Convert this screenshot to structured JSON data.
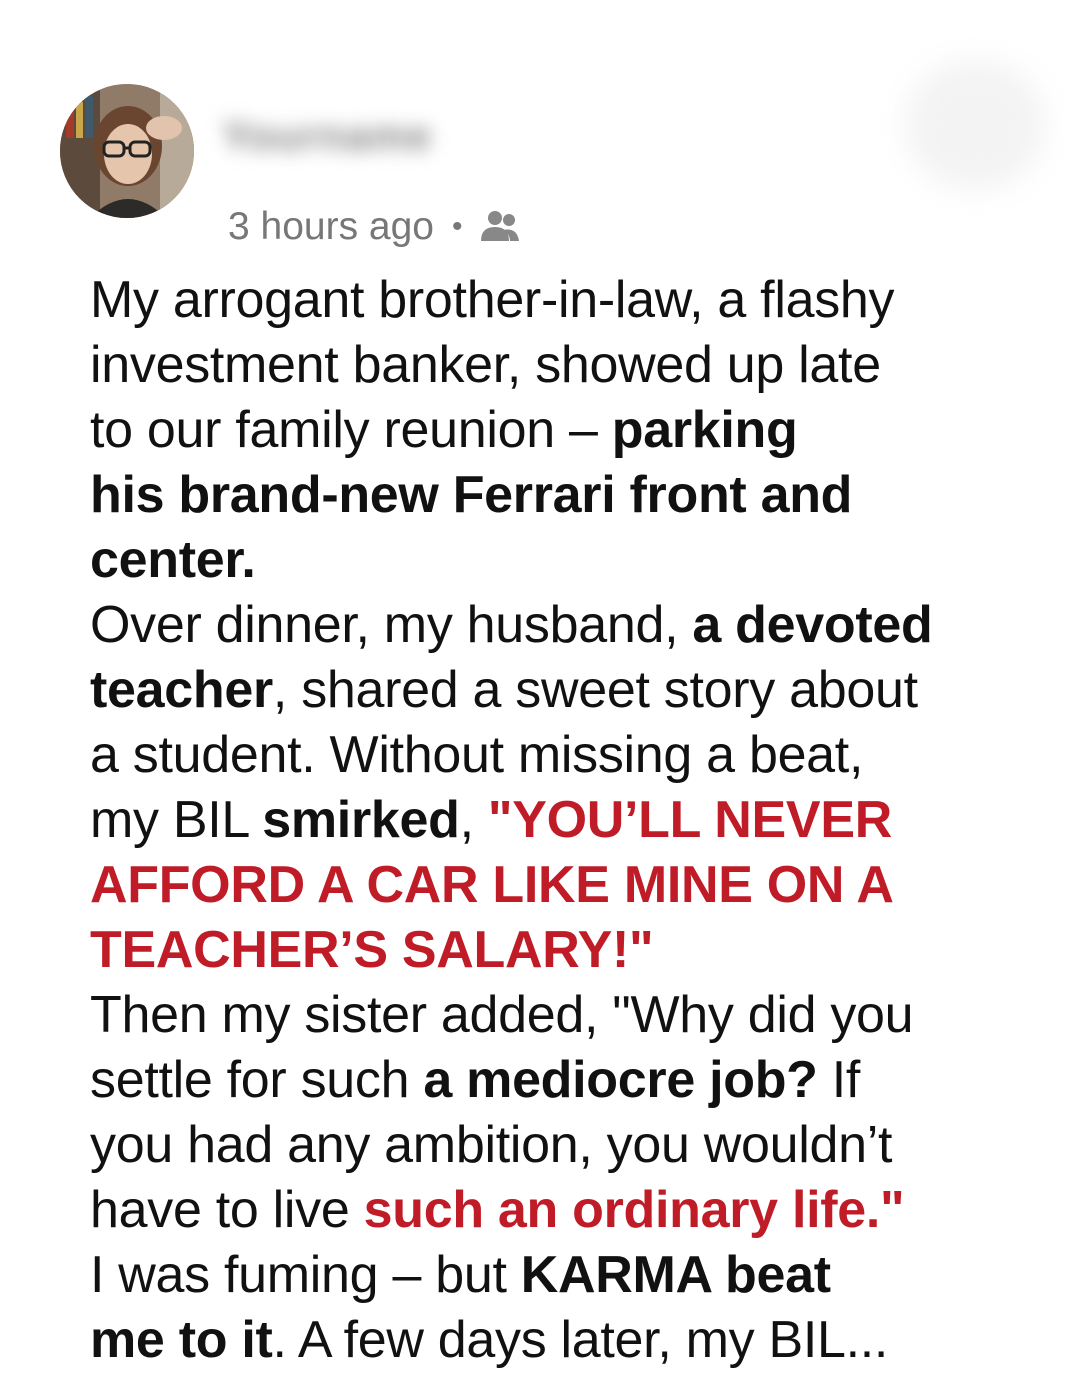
{
  "post": {
    "author_name": "Yourname",
    "timestamp": "3 hours ago",
    "separator": "•",
    "audience_icon": "friends-icon"
  },
  "body": {
    "lines": [
      [
        {
          "t": "My arrogant brother-in-law, a flashy",
          "s": "n"
        }
      ],
      [
        {
          "t": "investment banker, showed up late",
          "s": "n"
        }
      ],
      [
        {
          "t": "to our family reunion – ",
          "s": "n"
        },
        {
          "t": "parking",
          "s": "b"
        }
      ],
      [
        {
          "t": "his brand-new Ferrari front and",
          "s": "b"
        }
      ],
      [
        {
          "t": "center.",
          "s": "b"
        }
      ],
      [
        {
          "t": "Over dinner, my husband, ",
          "s": "n"
        },
        {
          "t": "a devoted",
          "s": "b"
        }
      ],
      [
        {
          "t": "teacher",
          "s": "b"
        },
        {
          "t": ", shared a sweet story about",
          "s": "n"
        }
      ],
      [
        {
          "t": "a student. Without missing a beat,",
          "s": "n"
        }
      ],
      [
        {
          "t": "my BIL ",
          "s": "n"
        },
        {
          "t": "smirked",
          "s": "b"
        },
        {
          "t": ", ",
          "s": "n"
        },
        {
          "t": "\"YOU’LL NEVER",
          "s": "r"
        }
      ],
      [
        {
          "t": "AFFORD A CAR LIKE MINE ON A",
          "s": "r"
        }
      ],
      [
        {
          "t": "TEACHER’S SALARY!\"",
          "s": "r"
        }
      ],
      [
        {
          "t": "Then my sister added, \"Why did you",
          "s": "n"
        }
      ],
      [
        {
          "t": "settle for such ",
          "s": "n"
        },
        {
          "t": "a mediocre job?",
          "s": "b"
        },
        {
          "t": " If",
          "s": "n"
        }
      ],
      [
        {
          "t": "you had any ambition, you wouldn’t",
          "s": "n"
        }
      ],
      [
        {
          "t": "have to live ",
          "s": "n"
        },
        {
          "t": "such an ordinary life.\"",
          "s": "r"
        }
      ],
      [
        {
          "t": "I was fuming – but ",
          "s": "n"
        },
        {
          "t": "KARMA beat",
          "s": "b"
        }
      ],
      [
        {
          "t": "me to it",
          "s": "b"
        },
        {
          "t": ". A few days later, my BIL...",
          "s": "n"
        }
      ]
    ]
  }
}
